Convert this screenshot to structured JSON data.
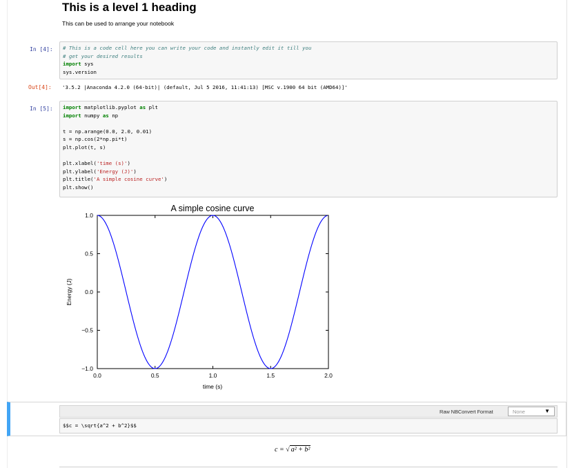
{
  "notebook": {
    "heading": "This is a level 1 heading",
    "markdown_text": "This can be used to arrange your notebook",
    "cell1": {
      "in_prompt": "In [4]:",
      "code_lines": [
        {
          "cls": "cm",
          "text": "# This is a code cell here you can write your code and instantly edit it till you"
        },
        {
          "cls": "cm",
          "text": "# get your desired results"
        },
        {
          "cls": "kw",
          "text": "import",
          "rest": " sys"
        },
        {
          "cls": "",
          "text": "sys.version"
        }
      ],
      "out_prompt": "Out[4]:",
      "output": "'3.5.2 |Anaconda 4.2.0 (64-bit)| (default, Jul  5 2016, 11:41:13) [MSC v.1900 64 bit (AMD64)]'"
    },
    "cell2": {
      "in_prompt": "In [5]:",
      "code": [
        "import matplotlib.pyplot as plt",
        "import numpy as np",
        "",
        "t = np.arange(0.0, 2.0, 0.01)",
        "s = np.cos(2*np.pi*t)",
        "plt.plot(t, s)",
        "",
        "plt.xlabel('time (s)')",
        "plt.ylabel('Energy (J)')",
        "plt.title('A simple cosine curve')",
        "plt.show()"
      ]
    },
    "raw_cell": {
      "format_label": "Raw NBConvert Format",
      "format_value": "None",
      "content": "$$c = \\sqrt{a^2 + b^2}$$"
    },
    "rendered_formula": {
      "lhs": "c = ",
      "radicand": "a² + b²"
    }
  },
  "chart_data": {
    "type": "line",
    "title": "A simple cosine curve",
    "xlabel": "time (s)",
    "ylabel": "Energy (J)",
    "xlim": [
      0.0,
      2.0
    ],
    "ylim": [
      -1.0,
      1.0
    ],
    "x_ticks": [
      "0.0",
      "0.5",
      "1.0",
      "1.5",
      "2.0"
    ],
    "y_ticks": [
      "1.0",
      "0.5",
      "0.0",
      "−0.5",
      "−1.0"
    ],
    "function": "cos(2*pi*t)",
    "t_start": 0.0,
    "t_stop": 2.0,
    "t_step": 0.01,
    "line_color": "#0000ff",
    "grid": false,
    "series": [
      {
        "x": [
          0.0,
          0.25,
          0.5,
          0.75,
          1.0,
          1.25,
          1.5,
          1.75,
          1.99
        ],
        "y": [
          1.0,
          0.0,
          -1.0,
          0.0,
          1.0,
          0.0,
          -1.0,
          0.0,
          1.0
        ]
      }
    ]
  },
  "colors": {
    "in_prompt": "#303f9f",
    "out_prompt": "#d84315",
    "raw_cell_accent": "#42a5f5"
  }
}
